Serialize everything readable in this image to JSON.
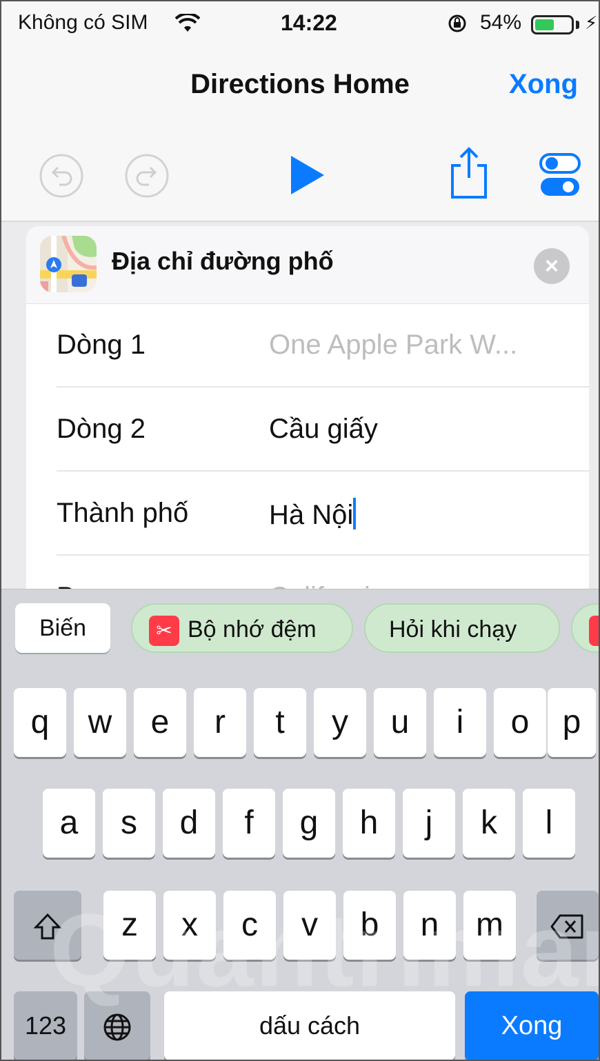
{
  "status_bar": {
    "carrier": "Không có SIM",
    "time": "14:22",
    "battery_percent": "54%",
    "battery_level": 0.54,
    "icons": [
      "wifi-icon",
      "rotation-lock-icon",
      "battery-icon",
      "charging-icon"
    ]
  },
  "nav": {
    "title": "Directions Home",
    "done_label": "Xong"
  },
  "toolbar": {
    "icons": [
      "undo-icon",
      "redo-icon",
      "play-icon",
      "share-icon",
      "settings-toggle-icon"
    ]
  },
  "action_card": {
    "title": "Địa chỉ đường phố",
    "icon": "maps-app-icon",
    "fields": [
      {
        "label": "Dòng 1",
        "value": "One Apple Park W...",
        "placeholder": true
      },
      {
        "label": "Dòng 2",
        "value": "Cầu giấy",
        "placeholder": false
      },
      {
        "label": "Thành phố",
        "value": "Hà Nội",
        "placeholder": false
      },
      {
        "label": "Bang",
        "value": "California",
        "placeholder": true
      }
    ]
  },
  "suggestions": {
    "variables_label": "Biến",
    "chips": [
      "Bộ nhớ đệm",
      "Hỏi khi chạy"
    ]
  },
  "keyboard": {
    "row1": [
      "q",
      "w",
      "e",
      "r",
      "t",
      "y",
      "u",
      "i",
      "o",
      "p"
    ],
    "row2": [
      "a",
      "s",
      "d",
      "f",
      "g",
      "h",
      "j",
      "k",
      "l"
    ],
    "row3": [
      "z",
      "x",
      "c",
      "v",
      "b",
      "n",
      "m"
    ],
    "numbers_label": "123",
    "space_label": "dấu cách",
    "return_label": "Xong"
  },
  "watermark": "Quantrimang",
  "colors": {
    "accent": "#0a7bff",
    "battery_green": "#34c759",
    "chip_green": "#cfe9cf",
    "chip_red": "#ff3b48"
  }
}
